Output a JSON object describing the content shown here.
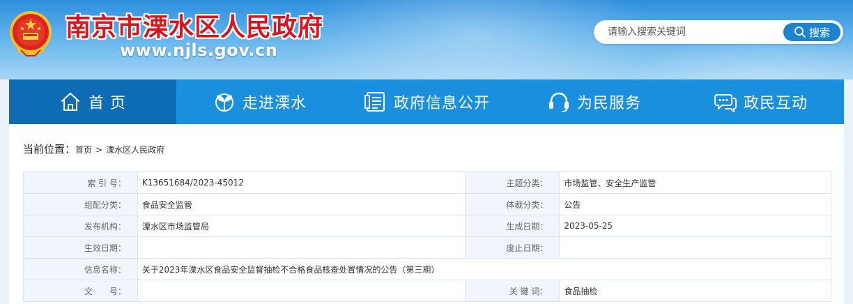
{
  "header": {
    "site_title": "南京市溧水区人民政府",
    "site_url": "www.njls.gov.cn",
    "emblem_icon": "national-emblem-icon"
  },
  "search": {
    "placeholder": "请输入搜索关键词",
    "button_label": "搜索",
    "icon": "search-icon"
  },
  "nav": {
    "items": [
      {
        "label": "首  页",
        "icon": "home-icon",
        "active": true
      },
      {
        "label": "走进溧水",
        "icon": "sprout-icon",
        "active": false
      },
      {
        "label": "政府信息公开",
        "icon": "document-icon",
        "active": false
      },
      {
        "label": "为民服务",
        "icon": "headset-icon",
        "active": false
      },
      {
        "label": "政民互动",
        "icon": "chat-icon",
        "active": false
      }
    ]
  },
  "breadcrumb": {
    "title": "当前位置：",
    "items": [
      "首页",
      "溧水区人民政府"
    ],
    "separator": ">"
  },
  "info_table": {
    "rows": [
      {
        "l1": "索 引 号：",
        "v1": "K13651684/2023-45012",
        "l2": "主题分类：",
        "v2": "市场监管、安全生产监管"
      },
      {
        "l1": "组配分类：",
        "v1": "食品安全监管",
        "l2": "体裁分类：",
        "v2": "公告"
      },
      {
        "l1": "发布机构：",
        "v1": "溧水区市场监管局",
        "l2": "生成日期：",
        "v2": "2023-05-25"
      },
      {
        "l1": "生效日期：",
        "v1": "",
        "l2": "废止日期：",
        "v2": ""
      },
      {
        "l1": "信息名称：",
        "v1": "关于2023年溧水区食品安全监督抽检不合格食品核查处置情况的公告（第三期）"
      },
      {
        "l1": "文　　号：",
        "v1": "",
        "l2": "关 键 词：",
        "v2": "食品抽检"
      }
    ]
  },
  "colors": {
    "nav_bg": "#1a8fde",
    "nav_active": "#0d6cb3",
    "title_red": "#d8141c",
    "label_bg": "#f0f6fc"
  }
}
